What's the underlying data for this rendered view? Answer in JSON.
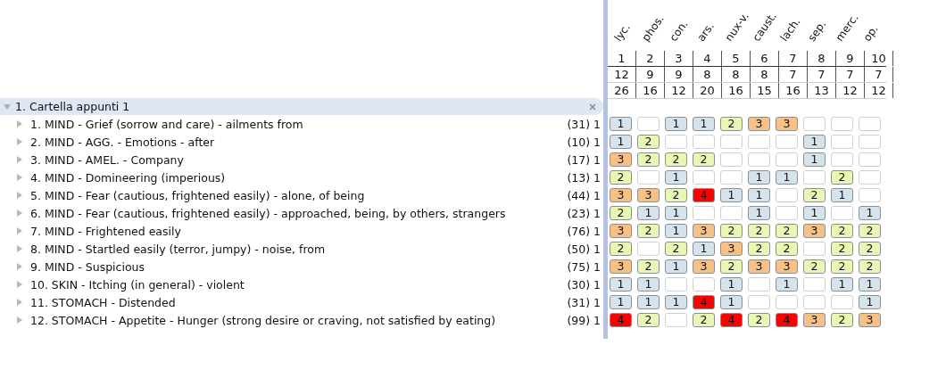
{
  "folder": {
    "label": "1. Cartella appunti 1",
    "expanded": true
  },
  "remedies": [
    {
      "name": "lyc.",
      "rank": "1",
      "count": "12",
      "score": "26"
    },
    {
      "name": "phos.",
      "rank": "2",
      "count": "9",
      "score": "16"
    },
    {
      "name": "con.",
      "rank": "3",
      "count": "9",
      "score": "12"
    },
    {
      "name": "ars.",
      "rank": "4",
      "count": "8",
      "score": "20"
    },
    {
      "name": "nux-v.",
      "rank": "5",
      "count": "8",
      "score": "16"
    },
    {
      "name": "caust.",
      "rank": "6",
      "count": "8",
      "score": "15"
    },
    {
      "name": "lach.",
      "rank": "7",
      "count": "7",
      "score": "16"
    },
    {
      "name": "sep.",
      "rank": "8",
      "count": "7",
      "score": "13"
    },
    {
      "name": "merc.",
      "rank": "9",
      "count": "7",
      "score": "12"
    },
    {
      "name": "op.",
      "rank": "10",
      "count": "7",
      "score": "12"
    }
  ],
  "rubrics": [
    {
      "label": "1. MIND - Grief (sorrow and care) - ailments from",
      "count": "(31) 1",
      "expanded": false,
      "cells": [
        {
          "kind": "graded",
          "grade": "1",
          "color": "#d5e3ed"
        },
        {
          "kind": "empty"
        },
        {
          "kind": "graded",
          "grade": "1",
          "color": "#d5e3ed"
        },
        {
          "kind": "graded",
          "grade": "1",
          "color": "#d5e3ed"
        },
        {
          "kind": "graded",
          "grade": "2",
          "color": "#e8f7b4"
        },
        {
          "kind": "graded",
          "grade": "3",
          "color": "#f7c185"
        },
        {
          "kind": "graded",
          "grade": "3",
          "color": "#f7c185"
        },
        {
          "kind": "empty"
        },
        {
          "kind": "empty"
        },
        {
          "kind": "empty"
        }
      ]
    },
    {
      "label": "2. MIND - AGG. - Emotions - after",
      "count": "(10) 1",
      "expanded": false,
      "cells": [
        {
          "kind": "graded",
          "grade": "1",
          "color": "#d5e3ed"
        },
        {
          "kind": "graded",
          "grade": "2",
          "color": "#e8f7b4"
        },
        {
          "kind": "empty"
        },
        {
          "kind": "empty"
        },
        {
          "kind": "empty"
        },
        {
          "kind": "empty"
        },
        {
          "kind": "empty"
        },
        {
          "kind": "graded",
          "grade": "1",
          "color": "#d5e3ed"
        },
        {
          "kind": "empty"
        },
        {
          "kind": "empty"
        }
      ]
    },
    {
      "label": "3. MIND - AMEL. - Company",
      "count": "(17) 1",
      "expanded": false,
      "cells": [
        {
          "kind": "graded",
          "grade": "3",
          "color": "#f7c185"
        },
        {
          "kind": "graded",
          "grade": "2",
          "color": "#e8f7b4"
        },
        {
          "kind": "graded",
          "grade": "2",
          "color": "#e8f7b4"
        },
        {
          "kind": "graded",
          "grade": "2",
          "color": "#e8f7b4"
        },
        {
          "kind": "empty"
        },
        {
          "kind": "empty"
        },
        {
          "kind": "empty"
        },
        {
          "kind": "graded",
          "grade": "1",
          "color": "#d5e3ed"
        },
        {
          "kind": "empty"
        },
        {
          "kind": "empty"
        }
      ]
    },
    {
      "label": "4. MIND - Domineering (imperious)",
      "count": "(13) 1",
      "expanded": false,
      "cells": [
        {
          "kind": "graded",
          "grade": "2",
          "color": "#e8f7b4"
        },
        {
          "kind": "empty"
        },
        {
          "kind": "graded",
          "grade": "1",
          "color": "#d5e3ed"
        },
        {
          "kind": "empty"
        },
        {
          "kind": "empty"
        },
        {
          "kind": "graded",
          "grade": "1",
          "color": "#d5e3ed"
        },
        {
          "kind": "graded",
          "grade": "1",
          "color": "#d5e3ed"
        },
        {
          "kind": "empty"
        },
        {
          "kind": "graded",
          "grade": "2",
          "color": "#e8f7b4"
        },
        {
          "kind": "empty"
        }
      ]
    },
    {
      "label": "5. MIND - Fear (cautious, frightened easily) - alone, of being",
      "count": "(44) 1",
      "expanded": false,
      "cells": [
        {
          "kind": "graded",
          "grade": "3",
          "color": "#f7c185"
        },
        {
          "kind": "graded",
          "grade": "3",
          "color": "#f7c185"
        },
        {
          "kind": "graded",
          "grade": "2",
          "color": "#e8f7b4"
        },
        {
          "kind": "graded",
          "grade": "4",
          "color": "#ff0000"
        },
        {
          "kind": "graded",
          "grade": "1",
          "color": "#d5e3ed"
        },
        {
          "kind": "graded",
          "grade": "1",
          "color": "#d5e3ed"
        },
        {
          "kind": "empty"
        },
        {
          "kind": "graded",
          "grade": "2",
          "color": "#e8f7b4"
        },
        {
          "kind": "graded",
          "grade": "1",
          "color": "#d5e3ed"
        },
        {
          "kind": "empty"
        }
      ]
    },
    {
      "label": "6. MIND - Fear (cautious, frightened easily) - approached, being, by others, strangers",
      "count": "(23) 1",
      "expanded": false,
      "cells": [
        {
          "kind": "graded",
          "grade": "2",
          "color": "#e8f7b4"
        },
        {
          "kind": "graded",
          "grade": "1",
          "color": "#d5e3ed"
        },
        {
          "kind": "graded",
          "grade": "1",
          "color": "#d5e3ed"
        },
        {
          "kind": "empty"
        },
        {
          "kind": "empty"
        },
        {
          "kind": "graded",
          "grade": "1",
          "color": "#d5e3ed"
        },
        {
          "kind": "empty"
        },
        {
          "kind": "graded",
          "grade": "1",
          "color": "#d5e3ed"
        },
        {
          "kind": "empty"
        },
        {
          "kind": "graded",
          "grade": "1",
          "color": "#d5e3ed"
        }
      ]
    },
    {
      "label": "7. MIND - Frightened easily",
      "count": "(76) 1",
      "expanded": false,
      "cells": [
        {
          "kind": "graded",
          "grade": "3",
          "color": "#f7c185"
        },
        {
          "kind": "graded",
          "grade": "2",
          "color": "#e8f7b4"
        },
        {
          "kind": "graded",
          "grade": "1",
          "color": "#d5e3ed"
        },
        {
          "kind": "graded",
          "grade": "3",
          "color": "#f7c185"
        },
        {
          "kind": "graded",
          "grade": "2",
          "color": "#e8f7b4"
        },
        {
          "kind": "graded",
          "grade": "2",
          "color": "#e8f7b4"
        },
        {
          "kind": "graded",
          "grade": "2",
          "color": "#e8f7b4"
        },
        {
          "kind": "graded",
          "grade": "3",
          "color": "#f7c185"
        },
        {
          "kind": "graded",
          "grade": "2",
          "color": "#e8f7b4"
        },
        {
          "kind": "graded",
          "grade": "2",
          "color": "#e8f7b4"
        }
      ]
    },
    {
      "label": "8. MIND - Startled easily (terror, jumpy) - noise, from",
      "count": "(50) 1",
      "expanded": false,
      "cells": [
        {
          "kind": "graded",
          "grade": "2",
          "color": "#e8f7b4"
        },
        {
          "kind": "empty"
        },
        {
          "kind": "graded",
          "grade": "2",
          "color": "#e8f7b4"
        },
        {
          "kind": "graded",
          "grade": "1",
          "color": "#d5e3ed"
        },
        {
          "kind": "graded",
          "grade": "3",
          "color": "#f7c185"
        },
        {
          "kind": "graded",
          "grade": "2",
          "color": "#e8f7b4"
        },
        {
          "kind": "graded",
          "grade": "2",
          "color": "#e8f7b4"
        },
        {
          "kind": "empty"
        },
        {
          "kind": "graded",
          "grade": "2",
          "color": "#e8f7b4"
        },
        {
          "kind": "graded",
          "grade": "2",
          "color": "#e8f7b4"
        }
      ]
    },
    {
      "label": "9. MIND - Suspicious",
      "count": "(75) 1",
      "expanded": false,
      "cells": [
        {
          "kind": "graded",
          "grade": "3",
          "color": "#f7c185"
        },
        {
          "kind": "graded",
          "grade": "2",
          "color": "#e8f7b4"
        },
        {
          "kind": "graded",
          "grade": "1",
          "color": "#d5e3ed"
        },
        {
          "kind": "graded",
          "grade": "3",
          "color": "#f7c185"
        },
        {
          "kind": "graded",
          "grade": "2",
          "color": "#e8f7b4"
        },
        {
          "kind": "graded",
          "grade": "3",
          "color": "#f7c185"
        },
        {
          "kind": "graded",
          "grade": "3",
          "color": "#f7c185"
        },
        {
          "kind": "graded",
          "grade": "2",
          "color": "#e8f7b4"
        },
        {
          "kind": "graded",
          "grade": "2",
          "color": "#e8f7b4"
        },
        {
          "kind": "graded",
          "grade": "2",
          "color": "#e8f7b4"
        }
      ]
    },
    {
      "label": "10. SKIN - Itching (in general) - violent",
      "count": "(30) 1",
      "expanded": false,
      "cells": [
        {
          "kind": "graded",
          "grade": "1",
          "color": "#d5e3ed"
        },
        {
          "kind": "graded",
          "grade": "1",
          "color": "#d5e3ed"
        },
        {
          "kind": "empty"
        },
        {
          "kind": "empty"
        },
        {
          "kind": "graded",
          "grade": "1",
          "color": "#d5e3ed"
        },
        {
          "kind": "empty"
        },
        {
          "kind": "graded",
          "grade": "1",
          "color": "#d5e3ed"
        },
        {
          "kind": "empty"
        },
        {
          "kind": "graded",
          "grade": "1",
          "color": "#d5e3ed"
        },
        {
          "kind": "graded",
          "grade": "1",
          "color": "#d5e3ed"
        }
      ]
    },
    {
      "label": "11. STOMACH - Distended",
      "count": "(31) 1",
      "expanded": false,
      "cells": [
        {
          "kind": "graded",
          "grade": "1",
          "color": "#d5e3ed"
        },
        {
          "kind": "graded",
          "grade": "1",
          "color": "#d5e3ed"
        },
        {
          "kind": "graded",
          "grade": "1",
          "color": "#d5e3ed"
        },
        {
          "kind": "graded",
          "grade": "4",
          "color": "#ff0000"
        },
        {
          "kind": "graded",
          "grade": "1",
          "color": "#d5e3ed"
        },
        {
          "kind": "empty"
        },
        {
          "kind": "empty"
        },
        {
          "kind": "empty"
        },
        {
          "kind": "empty"
        },
        {
          "kind": "graded",
          "grade": "1",
          "color": "#d5e3ed"
        }
      ]
    },
    {
      "label": "12. STOMACH - Appetite - Hunger (strong desire or craving, not satisfied by eating)",
      "count": "(99) 1",
      "expanded": false,
      "cells": [
        {
          "kind": "graded",
          "grade": "4",
          "color": "#ff0000"
        },
        {
          "kind": "graded",
          "grade": "2",
          "color": "#e8f7b4"
        },
        {
          "kind": "empty"
        },
        {
          "kind": "graded",
          "grade": "2",
          "color": "#e8f7b4"
        },
        {
          "kind": "graded",
          "grade": "4",
          "color": "#ff0000"
        },
        {
          "kind": "graded",
          "grade": "2",
          "color": "#e8f7b4"
        },
        {
          "kind": "graded",
          "grade": "4",
          "color": "#ff0000"
        },
        {
          "kind": "graded",
          "grade": "3",
          "color": "#f7c185"
        },
        {
          "kind": "graded",
          "grade": "2",
          "color": "#e8f7b4"
        },
        {
          "kind": "graded",
          "grade": "3",
          "color": "#f7c185"
        }
      ]
    }
  ]
}
